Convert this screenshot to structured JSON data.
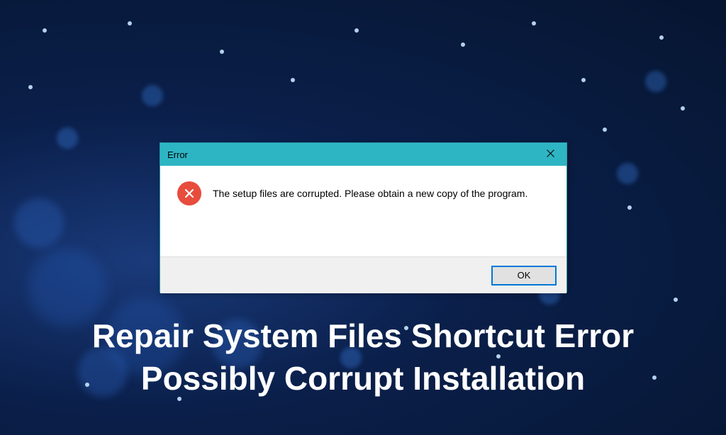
{
  "dialog": {
    "title": "Error",
    "message": "The setup files are corrupted. Please obtain a new copy of the program.",
    "ok_label": "OK"
  },
  "banner": {
    "line1": "Repair System Files Shortcut Error",
    "line2": "Possibly Corrupt Installation"
  }
}
